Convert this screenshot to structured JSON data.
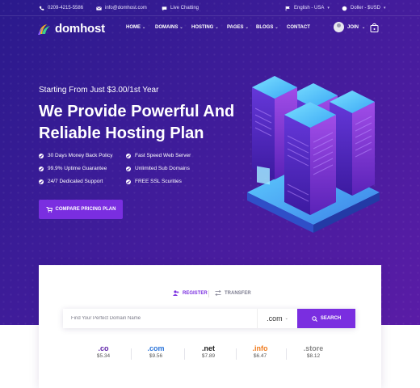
{
  "topbar": {
    "phone": "0209-4215-5586",
    "email": "info@domhost.com",
    "chat": "Live Chatting",
    "language": "English - USA",
    "currency": "Doller - $USD"
  },
  "nav": {
    "brand": "domhost",
    "menu": [
      "HOME",
      "DOMAINS",
      "HOSTING",
      "PAGES",
      "BLOGS",
      "CONTACT"
    ],
    "join": "JOIN"
  },
  "hero": {
    "kicker": "Starting From Just $3.00/1st Year",
    "headline": "We Provide Powerful And Reliable Hosting Plan",
    "features": [
      "30 Days Money Back Policy",
      "Fast Speed Web Server",
      "99.9% Uptime Guarantee",
      "Unlimited Sub Domains",
      "24/7 Dedicated Support",
      "FREE SSL Scurities"
    ],
    "cta": "COMPARE PRICING PLAN"
  },
  "domain_search": {
    "tabs": [
      "REGISTER",
      "TRANSFER"
    ],
    "active_tab": "REGISTER",
    "placeholder": "Find Your Perfect Domain Name",
    "selected_tld": ".com",
    "button": "SEARCH",
    "prices": [
      {
        "ext": ".co",
        "price": "$5.34",
        "color": "#5a1ca6"
      },
      {
        "ext": ".com",
        "price": "$9.56",
        "color": "#2a73d9"
      },
      {
        "ext": ".net",
        "price": "$7.89",
        "color": "#222222"
      },
      {
        "ext": ".info",
        "price": "$6.47",
        "color": "#f07a1c"
      },
      {
        "ext": ".store",
        "price": "$8.12",
        "color": "#8a8a8a"
      }
    ]
  },
  "colors": {
    "accent": "#7a2ee0",
    "hero_bg": "#3f1c9a"
  }
}
